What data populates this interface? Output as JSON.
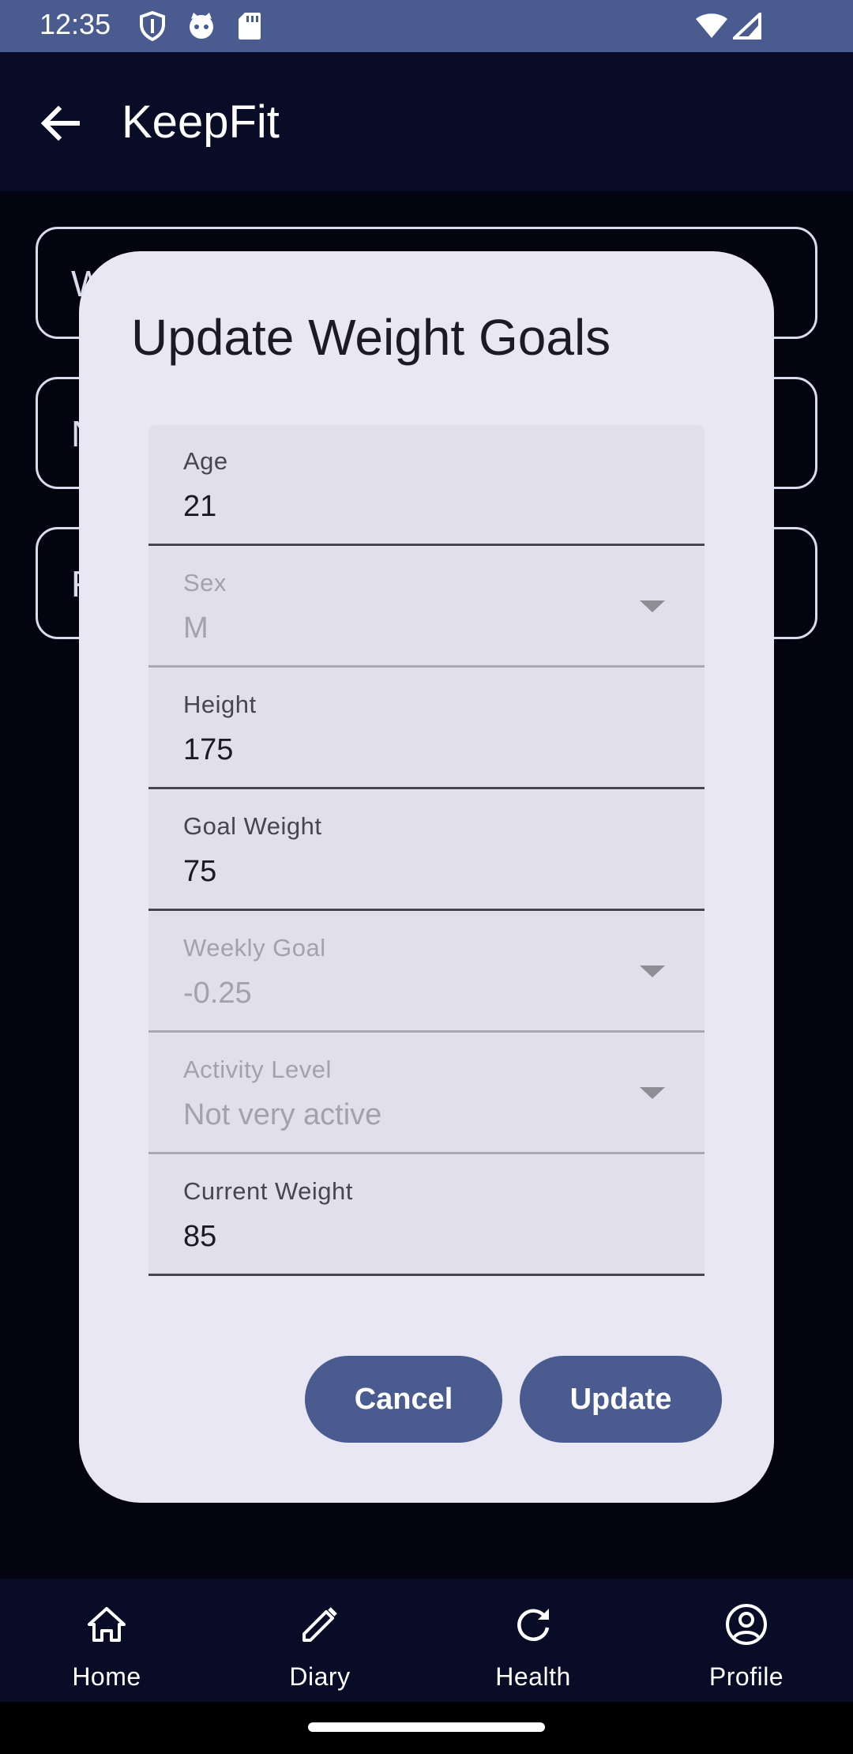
{
  "status_bar": {
    "time": "12:35",
    "icons": [
      "shield-icon",
      "cat-icon",
      "sd-card-icon",
      "wifi-icon",
      "signal-icon"
    ]
  },
  "app_bar": {
    "title": "KeepFit",
    "back_icon": "arrow-back-icon"
  },
  "background_cards": [
    {
      "label": "W"
    },
    {
      "label": "N"
    },
    {
      "label": "F"
    }
  ],
  "dialog": {
    "title": "Update Weight Goals",
    "fields": {
      "age": {
        "label": "Age",
        "value": "21"
      },
      "sex": {
        "label": "Sex",
        "value": "M"
      },
      "height": {
        "label": "Height",
        "value": "175"
      },
      "goal_weight": {
        "label": "Goal Weight",
        "value": "75"
      },
      "weekly_goal": {
        "label": "Weekly Goal",
        "value": "-0.25"
      },
      "activity_level": {
        "label": "Activity Level",
        "value": "Not very active"
      },
      "current_weight": {
        "label": "Current Weight",
        "value": "85"
      }
    },
    "cancel_label": "Cancel",
    "update_label": "Update"
  },
  "bottom_nav": {
    "items": [
      {
        "label": "Home",
        "icon": "home-icon"
      },
      {
        "label": "Diary",
        "icon": "pencil-icon"
      },
      {
        "label": "Health",
        "icon": "refresh-icon"
      },
      {
        "label": "Profile",
        "icon": "account-circle-icon"
      }
    ]
  },
  "colors": {
    "primary": "#4a5b8f",
    "background": "#080c26",
    "dialog": "#e9e7f3",
    "field": "#e1e0ea"
  }
}
